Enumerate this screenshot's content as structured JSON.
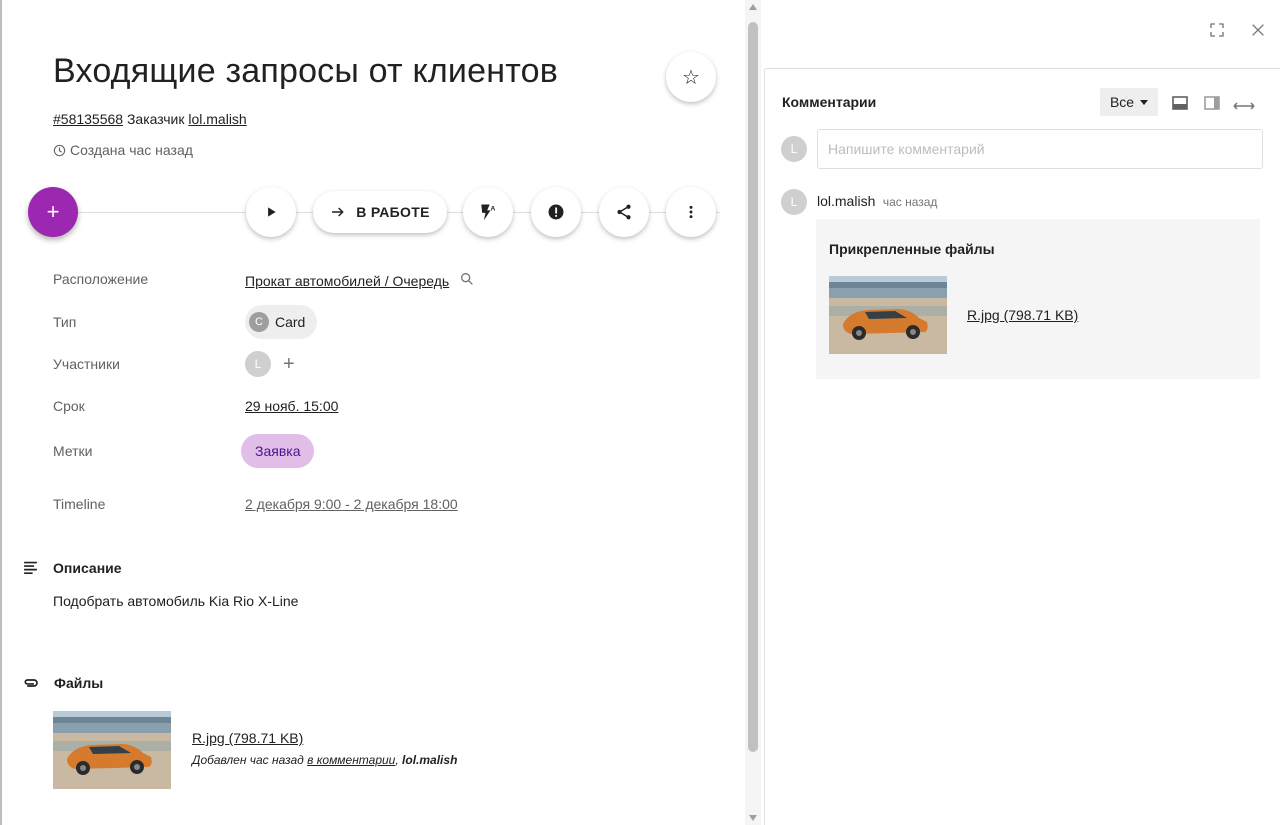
{
  "task": {
    "title": "Входящие запросы от клиентов",
    "id_link": "#58135568",
    "customer_label": "Заказчик",
    "customer_link": "lol.malish",
    "created": "Создана час назад"
  },
  "actions": {
    "add": "+",
    "status_label": "В РАБОТЕ"
  },
  "fields": {
    "location": {
      "label": "Расположение",
      "value": "Прокат автомобилей / Очередь"
    },
    "type": {
      "label": "Тип",
      "avatar_letter": "C",
      "value": "Card"
    },
    "participants": {
      "label": "Участники",
      "avatar_letter": "L",
      "add": "+"
    },
    "deadline": {
      "label": "Срок",
      "value": "29 нояб. 15:00"
    },
    "tags": {
      "label": "Метки",
      "value": "Заявка"
    },
    "timeline": {
      "label": "Timeline",
      "value": "2 декабря 9:00 - 2 декабря 18:00"
    }
  },
  "description": {
    "heading": "Описание",
    "text": "Подобрать автомобиль Kia Rio X-Line"
  },
  "files": {
    "heading": "Файлы",
    "file_name": "R.jpg (798.71 KB)",
    "added_prefix": "Добавлен час назад",
    "added_link": "в комментарии",
    "added_sep": ",",
    "added_author": "lol.malish"
  },
  "comments": {
    "title": "Комментарии",
    "filter": "Все",
    "input_avatar": "L",
    "input_placeholder": "Напишите комментарий",
    "items": [
      {
        "avatar": "L",
        "author": "lol.malish",
        "time": "час назад",
        "attachments_title": "Прикрепленные файлы",
        "attachment_name": "R.jpg (798.71 KB)"
      }
    ]
  },
  "colors": {
    "accent": "#9c27b0",
    "tag_bg": "#e1bee7",
    "chip_bg": "#eeeeee"
  }
}
